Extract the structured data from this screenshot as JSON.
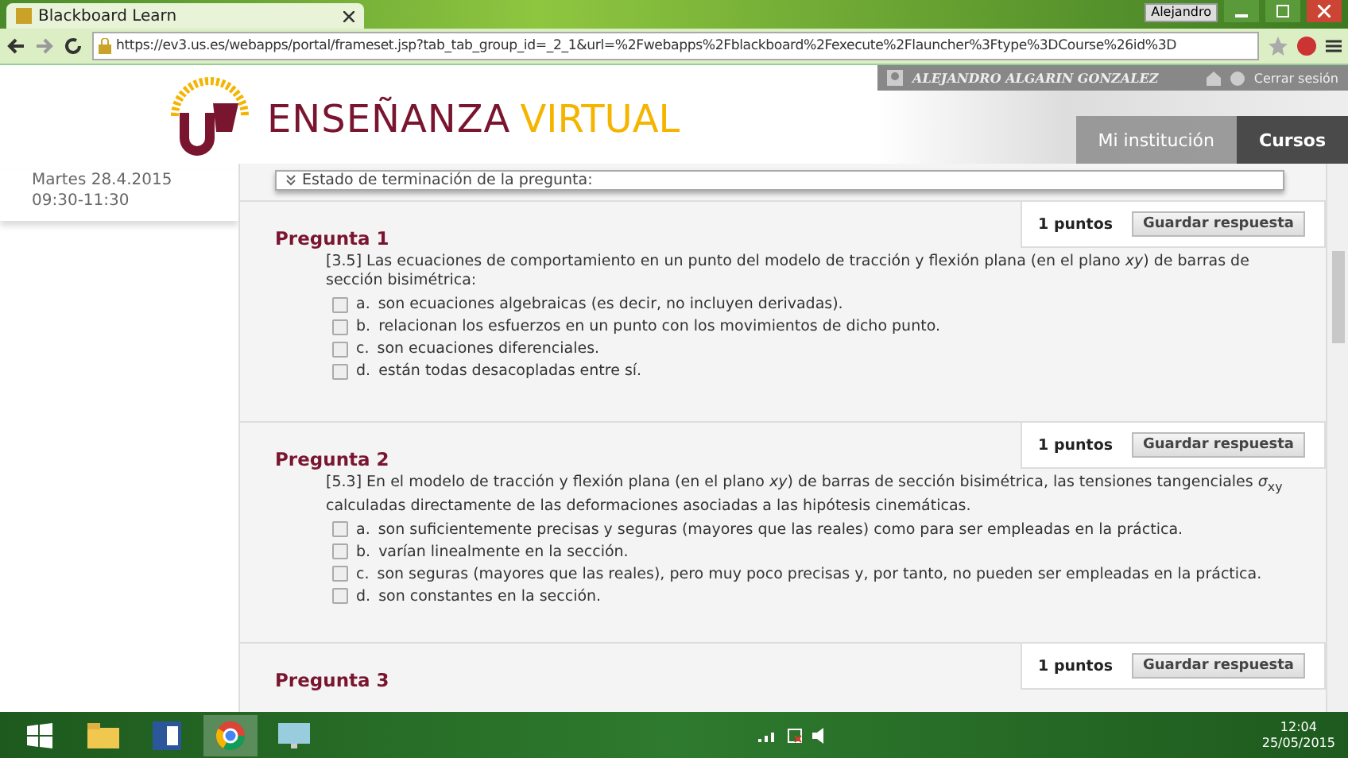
{
  "browser": {
    "tab_title": "Blackboard Learn",
    "user": "Alejandro",
    "url": "https://ev3.us.es/webapps/portal/frameset.jsp?tab_tab_group_id=_2_1&url=%2Fwebapps%2Fblackboard%2Fexecute%2Flauncher%3Ftype%3DCourse%26id%3D"
  },
  "header": {
    "title_first": "ENSEÑANZA",
    "title_second": "VIRTUAL",
    "user_name": "ALEJANDRO ALGARIN GONZALEZ",
    "logout": "Cerrar sesión",
    "tabs": [
      {
        "label": "Mi institución",
        "selected": false
      },
      {
        "label": "Cursos",
        "selected": true
      }
    ]
  },
  "sidebar": {
    "date": "Martes 28.4.2015",
    "time": "09:30-11:30"
  },
  "status_panel": {
    "label": "Estado de terminación de la pregunta:"
  },
  "questions": [
    {
      "title": "Pregunta 1",
      "points": "1 puntos",
      "save": "Guardar respuesta",
      "text": "[3.5] Las ecuaciones de comportamiento en un punto del modelo de tracción y flexión plana (en el plano *xy*) de barras de sección bisimétrica:",
      "options": [
        {
          "letter": "a.",
          "text": "son ecuaciones algebraicas (es decir, no incluyen derivadas).",
          "checked": false
        },
        {
          "letter": "b.",
          "text": "relacionan los esfuerzos en un punto con los movimientos de dicho punto.",
          "checked": false
        },
        {
          "letter": "c.",
          "text": "son ecuaciones diferenciales.",
          "checked": false
        },
        {
          "letter": "d.",
          "text": "están todas desacopladas entre sí.",
          "checked": false
        }
      ]
    },
    {
      "title": "Pregunta 2",
      "points": "1 puntos",
      "save": "Guardar respuesta",
      "text": "[5.3] En el modelo de tracción y flexión plana (en el plano *xy*) de barras de sección bisimétrica, las tensiones tangenciales *σ*$_{xy}$ calculadas directamente de las deformaciones asociadas a las hipótesis cinemáticas.",
      "options": [
        {
          "letter": "a.",
          "text": "son suficientemente precisas y seguras (mayores que las reales) como para ser empleadas en la práctica.",
          "checked": false
        },
        {
          "letter": "b.",
          "text": "varían linealmente en la sección.",
          "checked": false
        },
        {
          "letter": "c.",
          "text": "son seguras (mayores que las reales), pero muy poco precisas y, por tanto, no pueden ser empleadas en la práctica.",
          "checked": false
        },
        {
          "letter": "d.",
          "text": "son constantes en la sección.",
          "checked": false
        }
      ]
    },
    {
      "title": "Pregunta 3",
      "points": "1 puntos",
      "save": "Guardar respuesta"
    }
  ],
  "taskbar": {
    "time": "12:04",
    "date": "25/05/2015"
  }
}
